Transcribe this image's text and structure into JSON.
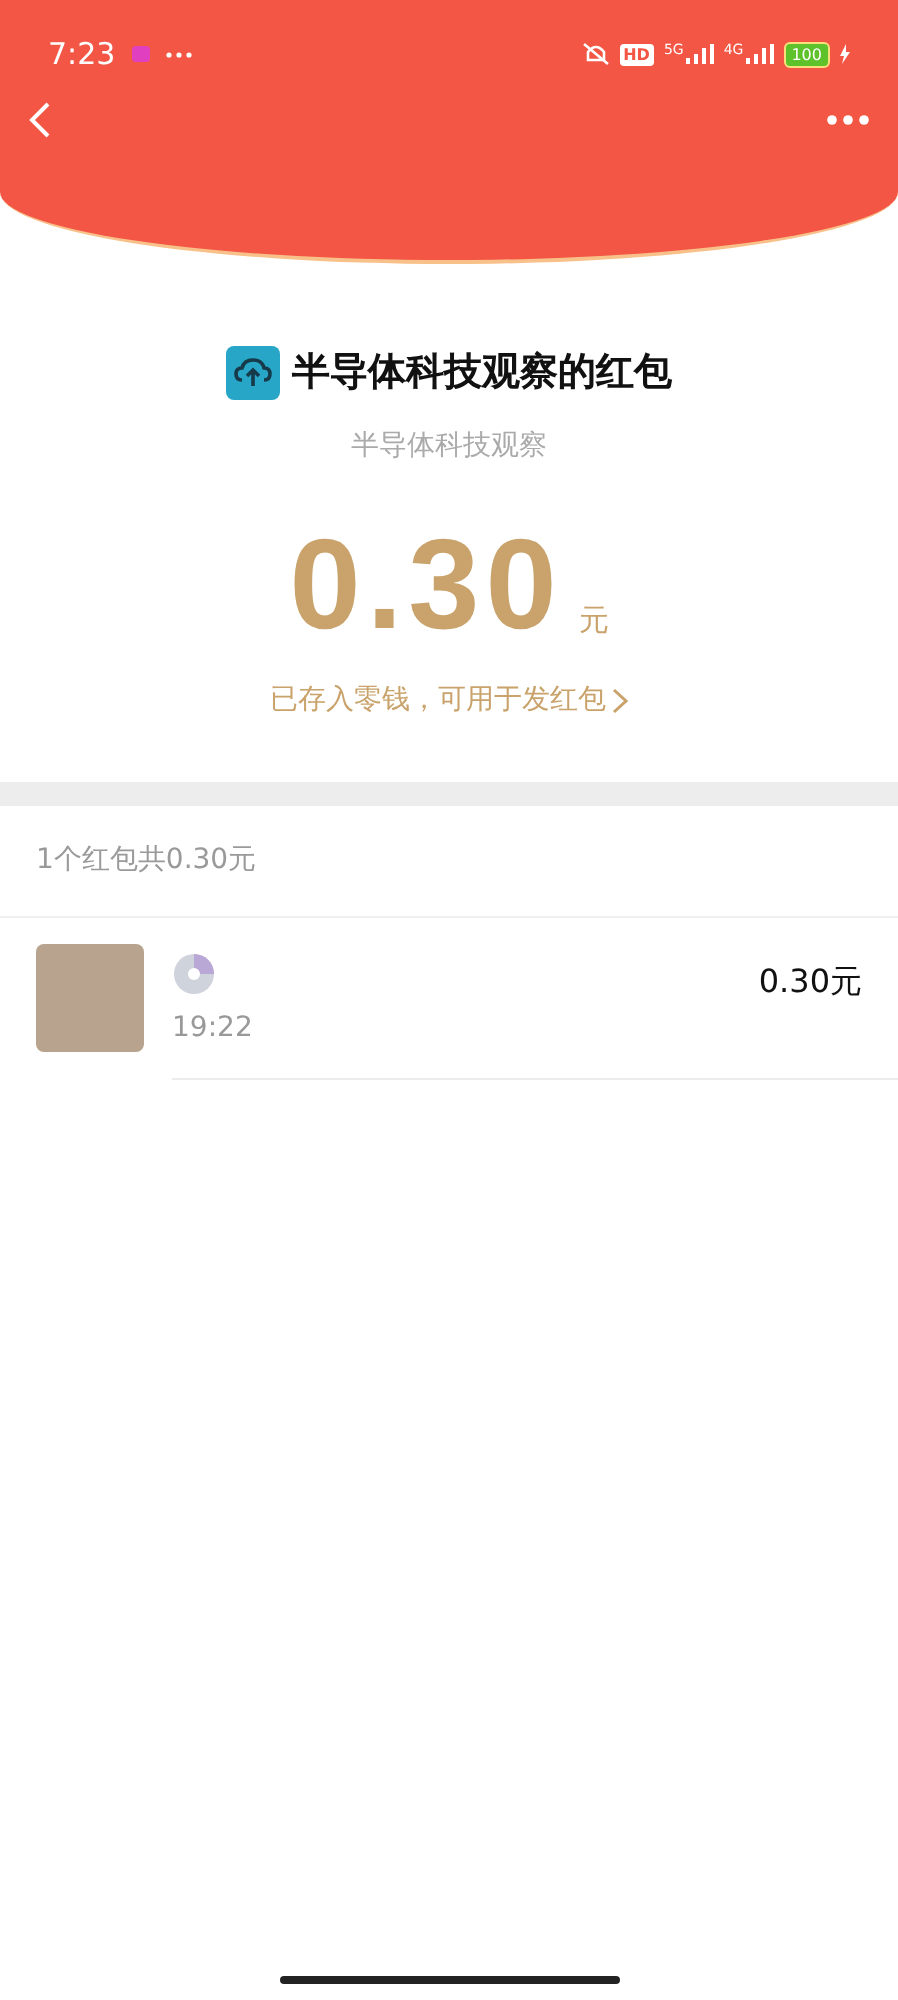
{
  "status_bar": {
    "time": "7:23",
    "hd": "HD",
    "networks": [
      "5G",
      "4G"
    ],
    "battery": "100"
  },
  "header": {
    "title": "半导体科技观察的红包",
    "subtitle": "半导体科技观察",
    "amount": "0.30",
    "unit": "元",
    "note": "已存入零钱，可用于发红包"
  },
  "summary": "1个红包共0.30元",
  "records": [
    {
      "time": "19:22",
      "amount": "0.30元"
    }
  ]
}
